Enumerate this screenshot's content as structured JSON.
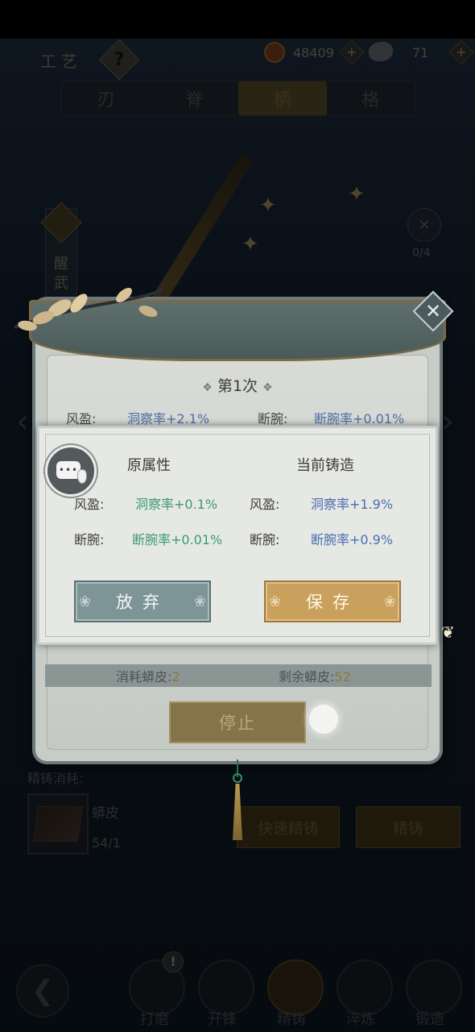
{
  "header": {
    "title": "工艺",
    "coins": "48409",
    "skins": "71"
  },
  "tabs": [
    {
      "label": "刃"
    },
    {
      "label": "脊"
    },
    {
      "label": "柄"
    },
    {
      "label": "格"
    }
  ],
  "side": {
    "badge_label": "醒武",
    "skill_count": "0/4"
  },
  "forging": {
    "count_title": "第1次",
    "row1_label": "风盈:",
    "row1_value": "洞察率+2.1%",
    "row2_label": "断腕:",
    "row2_value": "断腕率+0.01%",
    "consume_label": "消耗蟒皮:",
    "consume_value": "2",
    "remain_label": "剩余蟒皮:",
    "remain_value": "52",
    "stop_label": "停止"
  },
  "dialog": {
    "original_heading": "原属性",
    "current_heading": "当前铸造",
    "rows": [
      {
        "orig_label": "风盈:",
        "orig_value": "洞察率+0.1%",
        "cur_label": "风盈:",
        "cur_value": "洞察率+1.9%"
      },
      {
        "orig_label": "断腕:",
        "orig_value": "断腕率+0.01%",
        "cur_label": "断腕:",
        "cur_value": "断腕率+0.9%"
      }
    ],
    "abandon_label": "放弃",
    "save_label": "保存"
  },
  "cost": {
    "title": "精铸消耗:",
    "item_name": "蟒皮",
    "have": "54",
    "need": "/1",
    "quick_label": "快速精铸",
    "refine_label": "精铸"
  },
  "bottom_nav": [
    {
      "label": "打磨"
    },
    {
      "label": "开锋"
    },
    {
      "label": "精铸"
    },
    {
      "label": "淬炼"
    },
    {
      "label": "锻造"
    }
  ],
  "badge_count": "!",
  "colors": {
    "accent_gold": "#c9a05c",
    "stat_green": "#3d9a76",
    "stat_blue": "#4a6fb0"
  },
  "icons": [
    "help-icon",
    "coin-icon",
    "skin-icon",
    "plus-icon",
    "close-icon",
    "chat-icon",
    "back-icon"
  ]
}
